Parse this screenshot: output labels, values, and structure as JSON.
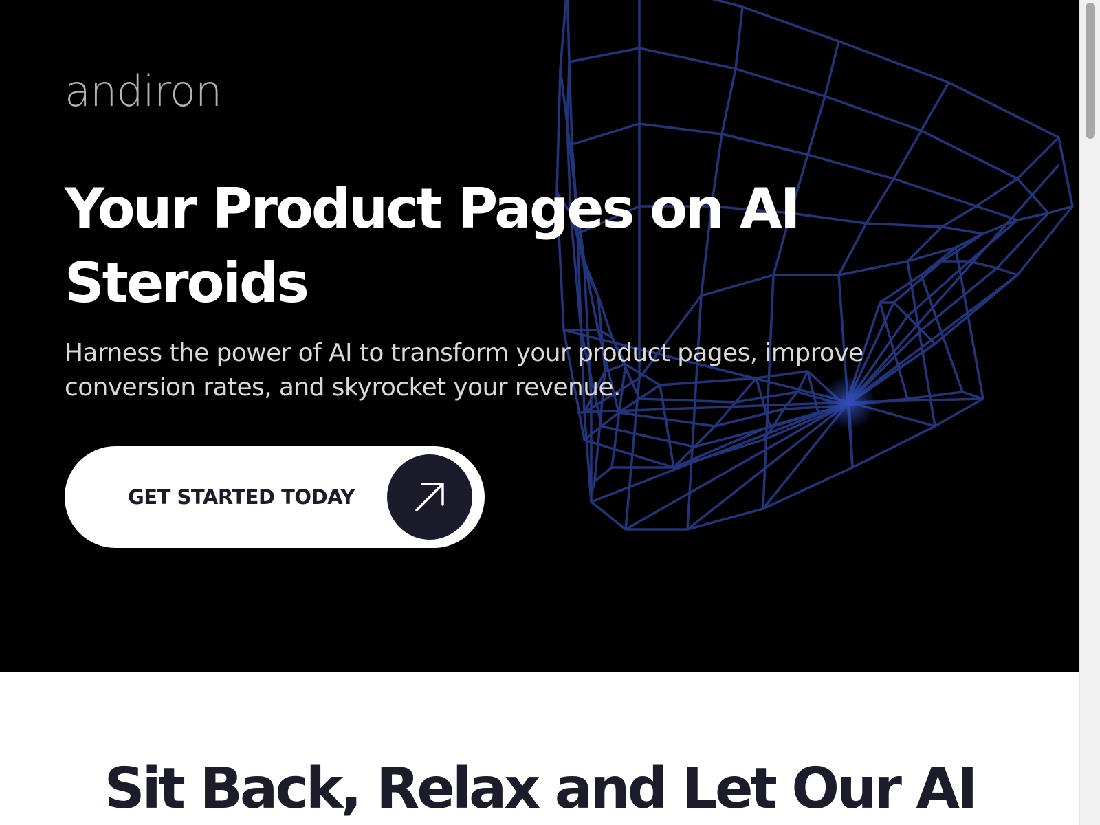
{
  "brand": {
    "logo_text": "andiron"
  },
  "hero": {
    "title": "Your Product Pages on AI Steroids",
    "subtitle": "Harness the power of AI to transform your product pages, improve conversion rates, and skyrocket your revenue.",
    "cta": {
      "label": "GET STARTED TODAY",
      "icon": "arrow-up-right-icon"
    },
    "decoration": "wireframe-cone"
  },
  "section": {
    "title": "Sit Back, Relax and Let Our AI"
  },
  "colors": {
    "hero_background": "#000000",
    "accent_dark": "#1b1b2b",
    "wireframe_blue": "#2a3f8f",
    "page_background": "#ffffff"
  }
}
